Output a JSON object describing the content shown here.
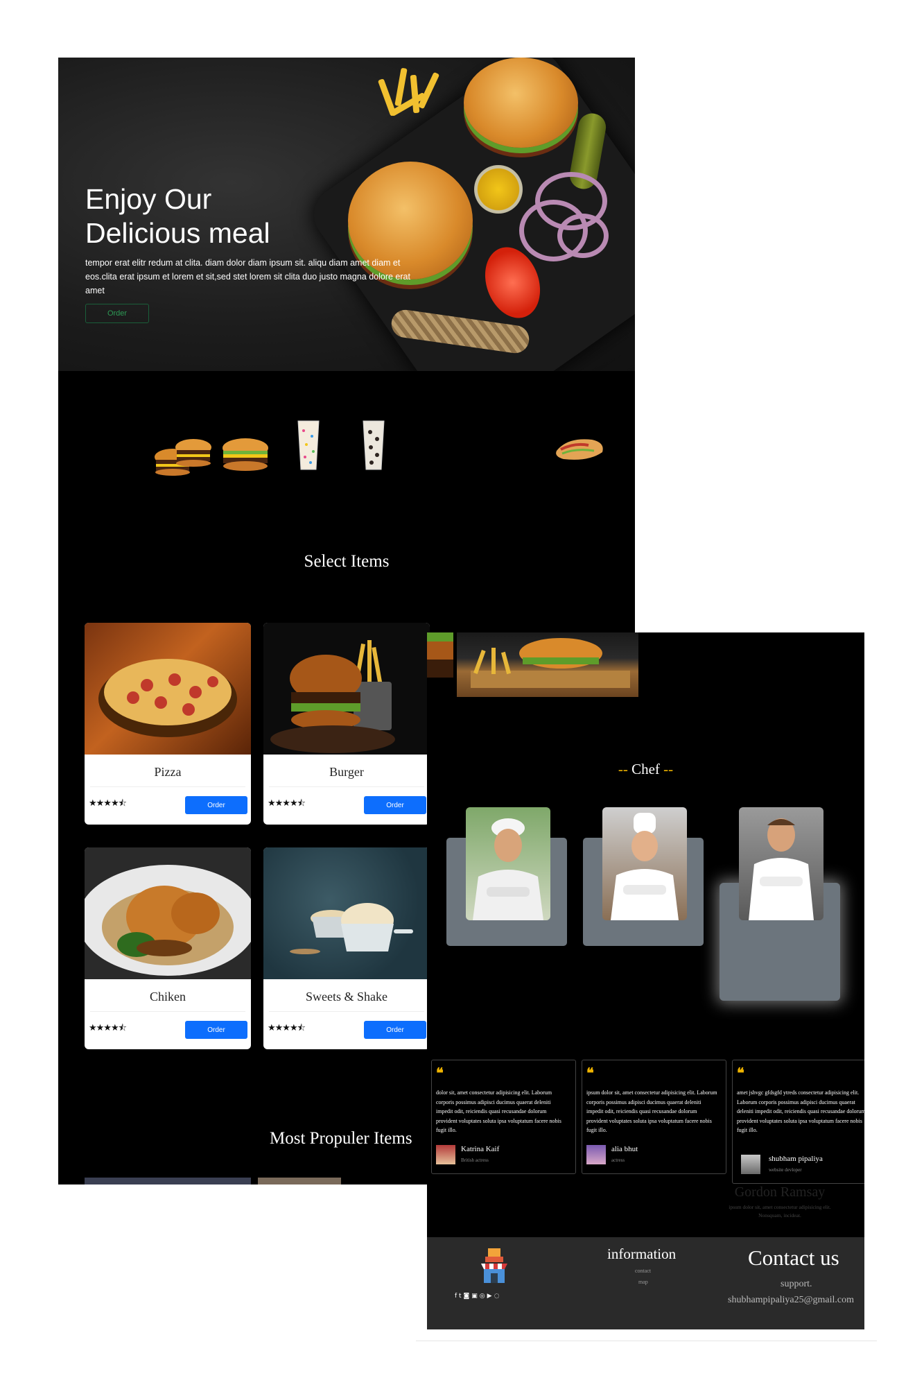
{
  "hero": {
    "title": "Enjoy Our\nDelicious meal",
    "text": "tempor erat elitr redum at clita. diam dolor diam ipsum sit. aliqu diam amet diam et eos.clita erat ipsum et lorem et sit,sed stet lorem sit clita duo justo magna dolore erat amet",
    "order_label": "Order"
  },
  "select_items": {
    "title": "Select Items",
    "cards": [
      {
        "name": "Pizza",
        "stars": "★★★★⯪",
        "order_label": "Order"
      },
      {
        "name": "Burger",
        "stars": "★★★★⯪",
        "order_label": "Order"
      },
      {
        "name": "Chiken",
        "stars": "★★★★⯪",
        "order_label": "Order"
      },
      {
        "name": "Sweets & Shake",
        "stars": "★★★★⯪",
        "order_label": "Order"
      }
    ]
  },
  "popular": {
    "title": "Most Propuler Items"
  },
  "chef": {
    "title": "Chef",
    "dash_left": "--",
    "dash_right": "--",
    "featured_name": "Gordon Ramsay",
    "featured_desc": "ipsum dolor sit, amet consectetur adipisicing elit. Nonsquam, incideat."
  },
  "testimonials": [
    {
      "quote": "dolor sit, amet consectetur adipisicing elit. Laborum corporis possimus adipisci ducimus quaerat deleniti impedit odit, reiciendis quasi recusandae dolorum provident voluptates soluta ipsa voluptatum facere nobis fugit illo.",
      "name": "Katrina Kaif",
      "role": "British actress"
    },
    {
      "quote": "ipsum dolor sit, amet consectetur adipisicing elit. Laborum corporis possimus adipisci ducimus quaerat deleniti impedit odit, reiciendis quasi recusandae dolorum provident voluptates soluta ipsa voluptatum facere nobis fugit illo.",
      "name": "alia bhut",
      "role": "actress"
    },
    {
      "quote": "amet jshvgc gfdsgfd ytreds consectetur adipisicing elit. Laborum corporis possimus adipisci ducimus quaerat deleniti impedit odit, reiciendis quasi recusandae dolorum provident voluptates soluta ipsa voluptatum facere nobis fugit illo.",
      "name": "shubham pipaliya",
      "role": "website devloper"
    }
  ],
  "footer": {
    "info_title": "information",
    "links": [
      "contact",
      "map"
    ],
    "contact_title": "Contact us",
    "support": "support.",
    "email": "shubhampipaliya25@gmail.com",
    "social_icons": [
      "facebook-icon",
      "twitter-icon",
      "instagram-icon",
      "linkedin-icon",
      "instagram-icon",
      "youtube-icon",
      "whatsapp-icon"
    ]
  },
  "colors": {
    "accent": "#0d6efd",
    "gold": "#f0b400",
    "chef_card": "#6c757d",
    "footer": "#2a2a2a"
  }
}
